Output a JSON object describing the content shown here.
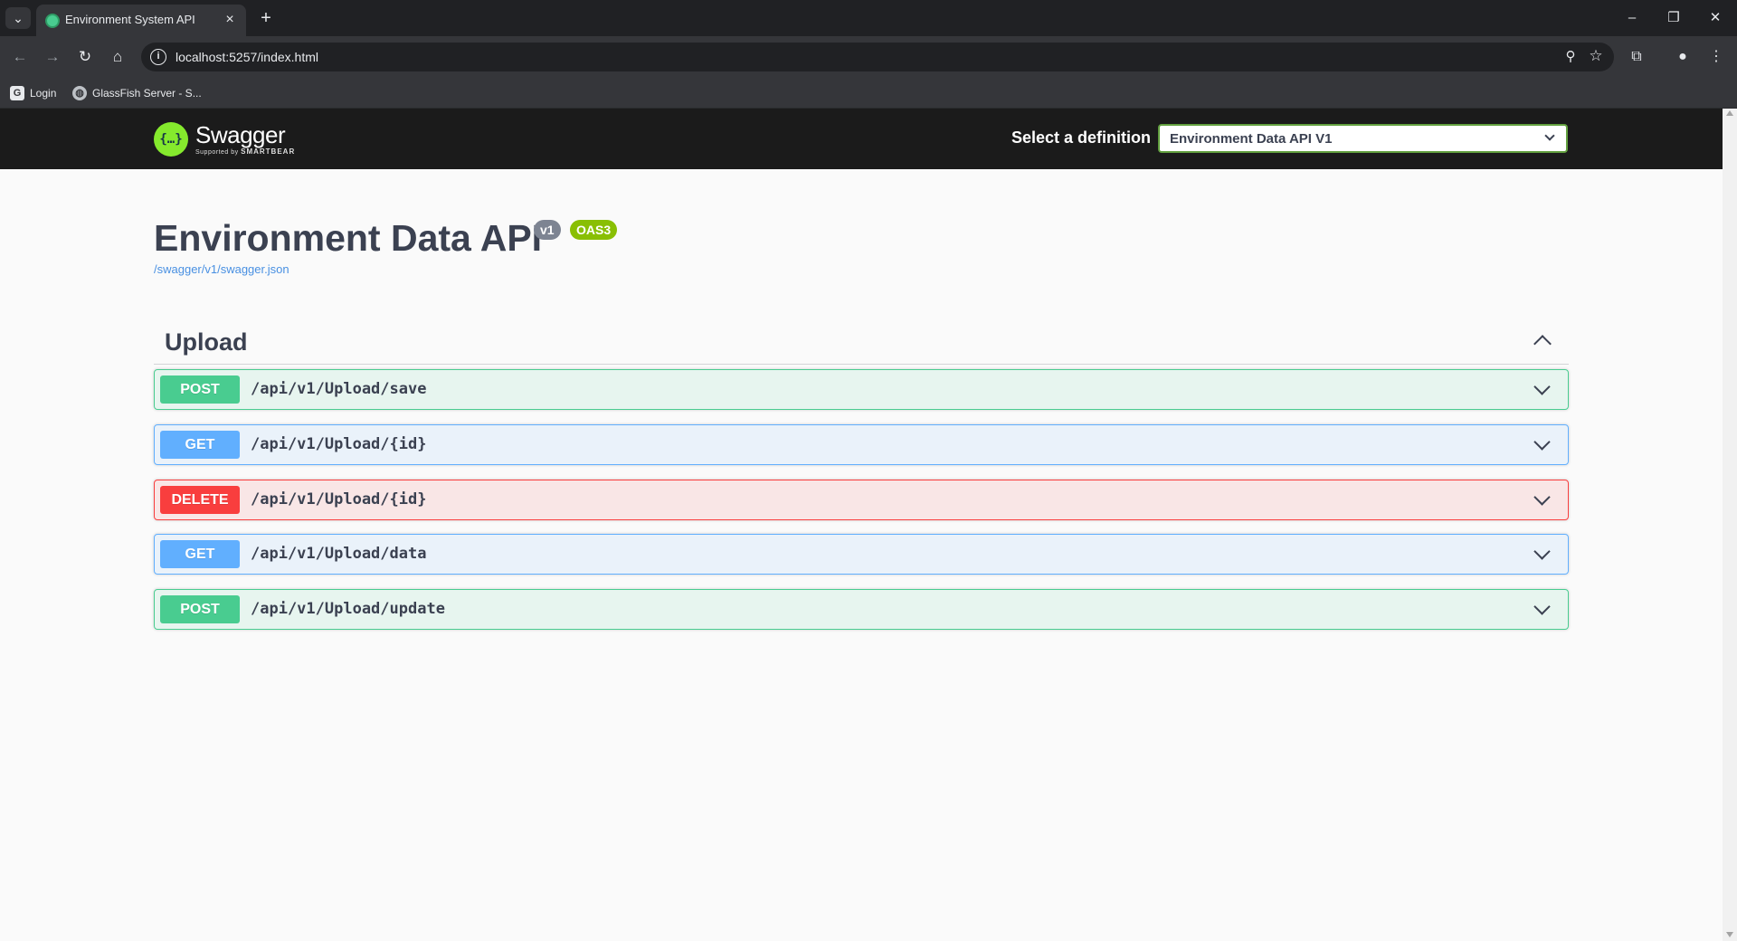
{
  "browser": {
    "tab_title": "Environment System API",
    "url": "localhost:5257/index.html",
    "bookmarks": [
      {
        "label": "Login"
      },
      {
        "label": "GlassFish Server - S..."
      }
    ]
  },
  "swagger": {
    "logo_word": "Swagger",
    "logo_sub": "Supported by",
    "logo_brand": "SMARTBEAR",
    "definition_label": "Select a definition",
    "definition_selected": "Environment Data API V1"
  },
  "info": {
    "title": "Environment Data API",
    "version": "v1",
    "oas": "OAS3",
    "spec_url": "/swagger/v1/swagger.json"
  },
  "tag": {
    "name": "Upload",
    "operations": [
      {
        "method": "POST",
        "path": "/api/v1/Upload/save"
      },
      {
        "method": "GET",
        "path": "/api/v1/Upload/{id}"
      },
      {
        "method": "DELETE",
        "path": "/api/v1/Upload/{id}"
      },
      {
        "method": "GET",
        "path": "/api/v1/Upload/data"
      },
      {
        "method": "POST",
        "path": "/api/v1/Upload/update"
      }
    ]
  },
  "colors": {
    "post": "#49cc90",
    "get": "#61affe",
    "delete": "#f93e3e",
    "swagger_green": "#85ea2d",
    "topbar": "#1b1b1b"
  }
}
